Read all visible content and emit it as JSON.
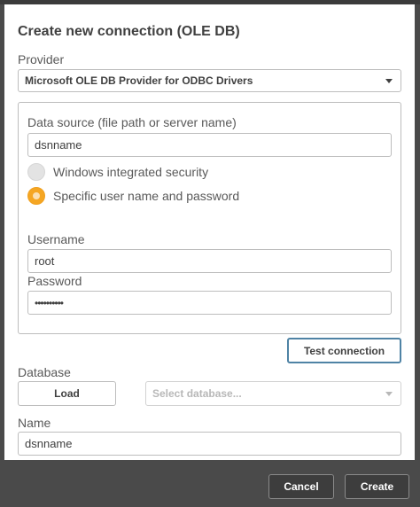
{
  "dialog": {
    "title": "Create new connection (OLE DB)"
  },
  "provider": {
    "label": "Provider",
    "selected": "Microsoft OLE DB Provider for ODBC Drivers"
  },
  "data_source": {
    "label": "Data source (file path or server name)",
    "value": "dsnname"
  },
  "auth": {
    "options": [
      {
        "label": "Windows integrated security",
        "selected": false
      },
      {
        "label": "Specific user name and password",
        "selected": true
      }
    ]
  },
  "username": {
    "label": "Username",
    "value": "root"
  },
  "password": {
    "label": "Password",
    "value": "••••••••••"
  },
  "test_connection": {
    "label": "Test connection"
  },
  "database": {
    "label": "Database",
    "load_label": "Load",
    "placeholder": "Select database..."
  },
  "name": {
    "label": "Name",
    "value": "dsnname"
  },
  "footer": {
    "cancel_label": "Cancel",
    "create_label": "Create"
  },
  "colors": {
    "accent_radio": "#f5a623",
    "focus_border": "#4f83a5",
    "footer_bg": "#4a4a4a"
  }
}
